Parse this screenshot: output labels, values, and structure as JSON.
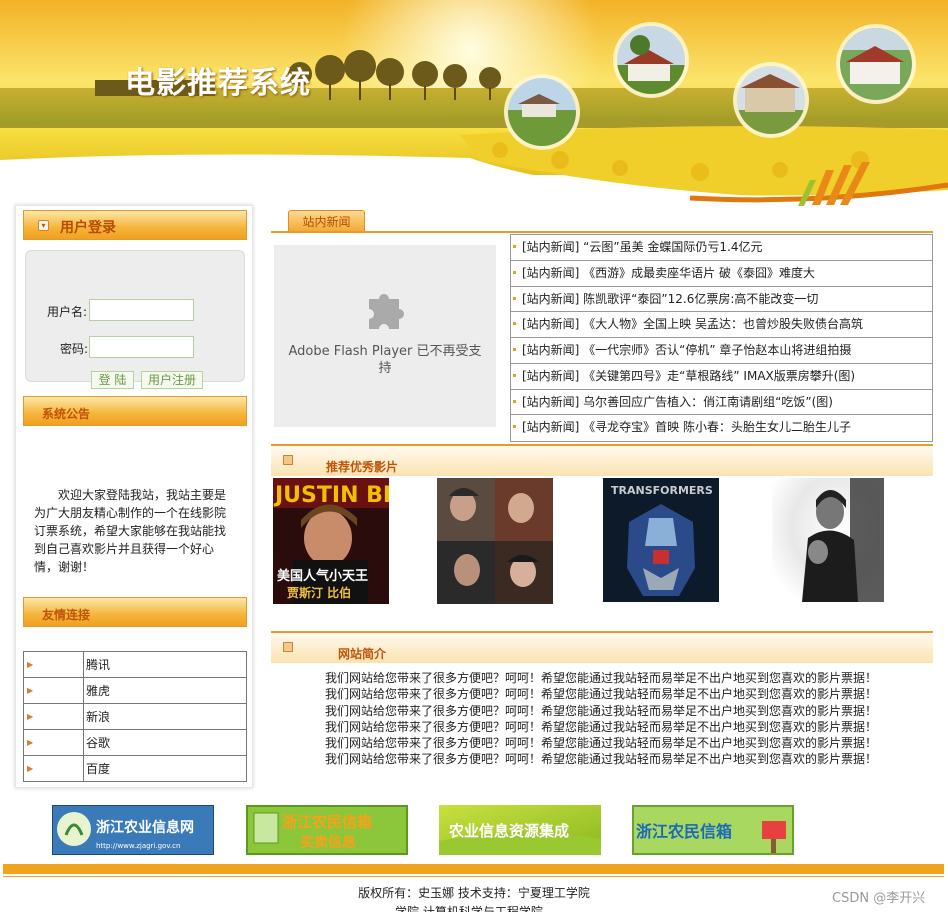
{
  "banner": {
    "site_title": "电影推荐系统"
  },
  "login": {
    "title": "用户登录",
    "username_label": "用户名:",
    "password_label": "密码:",
    "username_value": "",
    "password_value": "",
    "login_button": "登 陆",
    "register_button": "用户注册"
  },
  "announcement": {
    "title": "系统公告",
    "text": "欢迎大家登陆我站，我站主要是为广大朋友精心制作的一个在线影院订票系统，希望大家能够在我站能找到自己喜欢影片并且获得一个好心情，谢谢！"
  },
  "friend_links": {
    "title": "友情连接",
    "items": [
      "腾讯",
      "雅虎",
      "新浪",
      "谷歌",
      "百度"
    ]
  },
  "news": {
    "tab": "站内新闻",
    "flash_message": "Adobe Flash Player 已不再受支持",
    "items": [
      "[站内新闻] “云图”虽美 金蝶国际仍亏1.4亿元",
      "[站内新闻] 《西游》成最卖座华语片 破《泰囧》难度大",
      "[站内新闻] 陈凯歌评“泰囧”12.6亿票房:高不能改变一切",
      "[站内新闻] 《大人物》全国上映 吴孟达：也曾炒股失败债台高筑",
      "[站内新闻] 《一代宗师》否认“停机” 章子怡赵本山将进组拍摄",
      "[站内新闻] 《关键第四号》走“草根路线” IMAX版票房攀升(图)",
      "[站内新闻] 乌尔善回应广告植入：俏江南请剧组“吃饭”(图)",
      "[站内新闻] 《寻龙夺宝》首映 陈小春：头胎生女儿二胎生儿子"
    ]
  },
  "recommend": {
    "title": "推荐优秀影片",
    "posters": [
      {
        "name": "justin-bieber-poster",
        "caption_line1": "美国人气小天王",
        "caption_line2": "贾斯汀 比伯",
        "top_text": "JUSTIN BIE"
      },
      {
        "name": "ensemble-drama-poster"
      },
      {
        "name": "transformers-poster",
        "top_text": "TRANSFORMERS"
      },
      {
        "name": "black-white-drama-poster"
      }
    ]
  },
  "intro": {
    "title": "网站简介",
    "lines": [
      "我们网站给您带来了很多方便吧？呵呵！希望您能通过我站轻而易举足不出户地买到您喜欢的影片票据！",
      "我们网站给您带来了很多方便吧？呵呵！希望您能通过我站轻而易举足不出户地买到您喜欢的影片票据！",
      "我们网站给您带来了很多方便吧？呵呵！希望您能通过我站轻而易举足不出户地买到您喜欢的影片票据！",
      "我们网站给您带来了很多方便吧？呵呵！希望您能通过我站轻而易举足不出户地买到您喜欢的影片票据！",
      "我们网站给您带来了很多方便吧？呵呵！希望您能通过我站轻而易举足不出户地买到您喜欢的影片票据！",
      "我们网站给您带来了很多方便吧？呵呵！希望您能通过我站轻而易举足不出户地买到您喜欢的影片票据！"
    ]
  },
  "footer_logos": [
    {
      "name": "zj-agri-info-logo",
      "text": "浙江农业信息网",
      "sub": "http://www.zjagri.gov.cn"
    },
    {
      "name": "zj-farmer-trade-logo",
      "text": "浙江农民信箱",
      "sub": "买卖信息"
    },
    {
      "name": "agri-resource-logo",
      "text": "农业信息资源集成"
    },
    {
      "name": "zj-farmer-mailbox-logo",
      "text": "浙江农民信箱"
    }
  ],
  "footer": {
    "copyright": "版权所有：史玉娜 技术支持：宁夏理工学院",
    "cutoff_text": "学院 计算机科学与工程学院",
    "watermark": "CSDN @李开兴"
  },
  "colors": {
    "accent": "#f2a31e",
    "heading": "#b84c00",
    "border": "#e89a2a"
  }
}
